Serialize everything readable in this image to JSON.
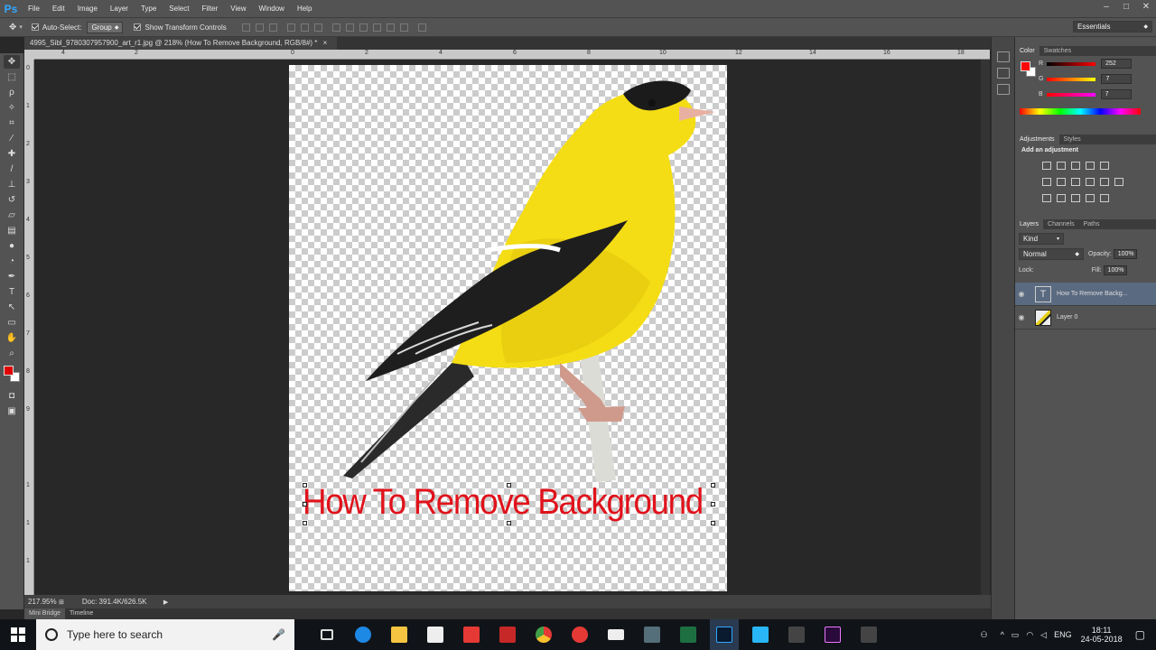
{
  "app": {
    "logo": "Ps"
  },
  "menu": [
    "File",
    "Edit",
    "Image",
    "Layer",
    "Type",
    "Select",
    "Filter",
    "View",
    "Window",
    "Help"
  ],
  "options": {
    "auto_select_label": "Auto-Select:",
    "auto_select_checked": true,
    "auto_select_value": "Group",
    "show_transform_label": "Show Transform Controls",
    "show_transform_checked": true,
    "workspace": "Essentials"
  },
  "document": {
    "tab_title": "4995_Sibl_9780307957900_art_r1.jpg @ 218% (How To Remove Background, RGB/8#) *",
    "close_glyph": "×",
    "text_layer_content": "How To Remove Background",
    "text_color": "#e0121b"
  },
  "rulers": {
    "h_labels": [
      "4",
      "2",
      "0",
      "2",
      "4",
      "6",
      "8",
      "10",
      "12",
      "14",
      "16",
      "18"
    ],
    "v_labels": [
      "0",
      "1",
      "2",
      "3",
      "4",
      "5",
      "6",
      "7",
      "8",
      "9",
      "1",
      "1",
      "1"
    ]
  },
  "status": {
    "zoom": "217.95%",
    "doc": "Doc: 391.4K/626.5K"
  },
  "bottom_tabs": [
    "Mini Bridge",
    "Timeline"
  ],
  "color_panel": {
    "tabs": [
      "Color",
      "Swatches"
    ],
    "r_label": "R",
    "r": "252",
    "g_label": "G",
    "g": "7",
    "b_label": "B",
    "b": "7",
    "foreground": "#fc0707"
  },
  "adjustments_panel": {
    "tabs": [
      "Adjustments",
      "Styles"
    ],
    "heading": "Add an adjustment"
  },
  "layers_panel": {
    "tabs": [
      "Layers",
      "Channels",
      "Paths"
    ],
    "kind": "Kind",
    "blend_mode": "Normal",
    "opacity_label": "Opacity:",
    "opacity": "100%",
    "lock_label": "Lock:",
    "fill_label": "Fill:",
    "fill": "100%",
    "layers": [
      {
        "name": "How To Remove Backg...",
        "type": "text",
        "selected": true
      },
      {
        "name": "Layer 0",
        "type": "image",
        "selected": false
      }
    ]
  },
  "taskbar": {
    "search_placeholder": "Type here to search",
    "lang": "ENG",
    "time": "18:11",
    "date": "24-05-2018"
  }
}
